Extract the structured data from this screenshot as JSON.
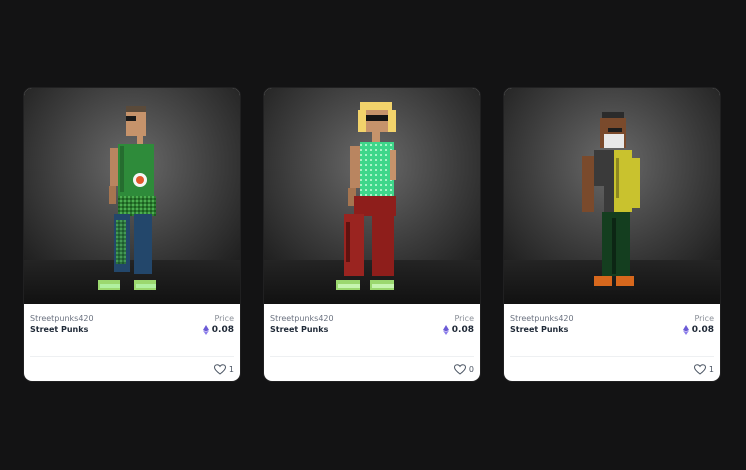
{
  "colors": {
    "page_background": "#131314",
    "card_background": "#ffffff",
    "eth_accent": "#6b5bd6"
  },
  "cards": [
    {
      "creator": "Streetpunks420",
      "collection": "Street Punks",
      "price_label": "Price",
      "price": "0.08",
      "currency_icon": "ethereum-icon",
      "likes": "1",
      "like_icon": "heart-outline-icon",
      "artwork": "pixel-art punk with green shirt and blue checkered jeans"
    },
    {
      "creator": "Streetpunks420",
      "collection": "Street Punks",
      "price_label": "Price",
      "price": "0.08",
      "currency_icon": "ethereum-icon",
      "likes": "0",
      "like_icon": "heart-outline-icon",
      "artwork": "pixel-art punk with blonde hair, teal shirt and red pants"
    },
    {
      "creator": "Streetpunks420",
      "collection": "Street Punks",
      "price_label": "Price",
      "price": "0.08",
      "currency_icon": "ethereum-icon",
      "likes": "1",
      "like_icon": "heart-outline-icon",
      "artwork": "pixel-art punk with face mask, yellow jacket and green pants"
    }
  ]
}
